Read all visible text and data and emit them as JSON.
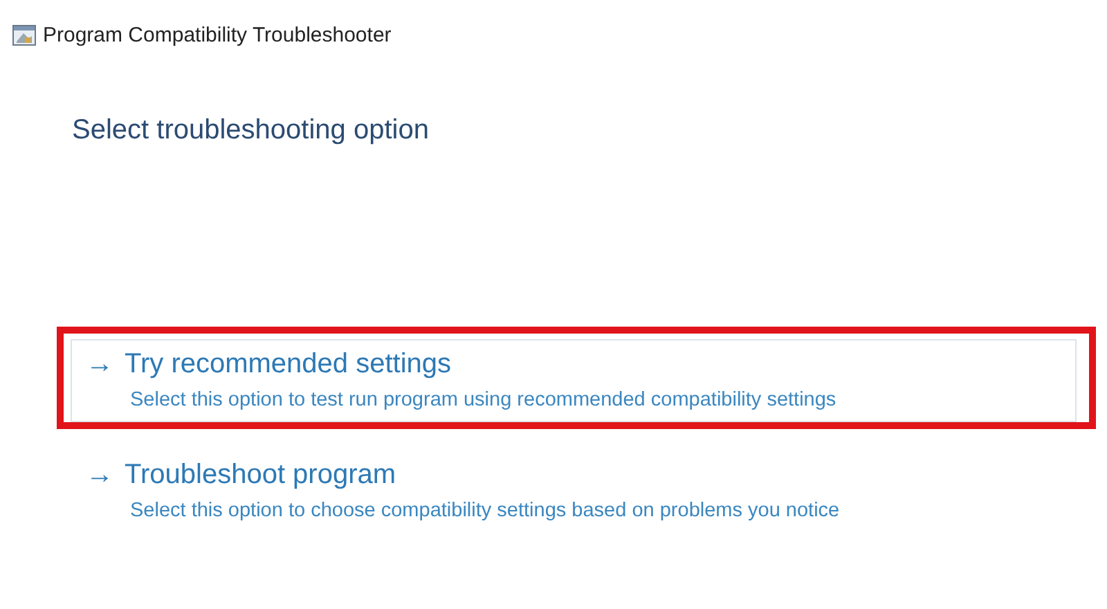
{
  "window": {
    "title": "Program Compatibility Troubleshooter"
  },
  "heading": "Select troubleshooting option",
  "options": [
    {
      "arrow": "→",
      "title": "Try recommended settings",
      "description": "Select this option to test run program using recommended compatibility settings",
      "selected": true,
      "annotated": true
    },
    {
      "arrow": "→",
      "title": "Troubleshoot program",
      "description": "Select this option to choose compatibility settings based on problems you notice",
      "selected": false,
      "annotated": false
    }
  ]
}
